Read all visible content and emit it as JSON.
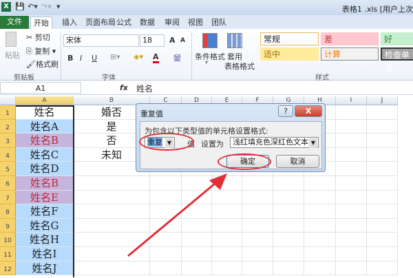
{
  "window": {
    "title": "表格1 .xls [用户上次"
  },
  "tabs": [
    "文件",
    "开始",
    "插入",
    "页面布局",
    "公式",
    "数据",
    "审阅",
    "视图",
    "团队"
  ],
  "ribbon": {
    "clipboard": {
      "paste": "粘贴",
      "cut": "剪切",
      "copy": "复制",
      "format_painter": "格式刷",
      "label": "剪贴板"
    },
    "font": {
      "name": "宋体",
      "size": "18",
      "label": "字体",
      "bold": "B",
      "italic": "I",
      "underline": "U",
      "font_color": "A",
      "grow": "A",
      "shrink": "A",
      "phonetic": "變"
    },
    "styles": {
      "conditional": "条件格式",
      "table_format_1": "套用",
      "table_format_2": "表格格式",
      "label": "样式",
      "items": [
        {
          "label": "常规",
          "bg": "#ffffff",
          "fg": "#222222"
        },
        {
          "label": "差",
          "bg": "#ffc7ce",
          "fg": "#9c0006"
        },
        {
          "label": "好",
          "bg": "#c6efce",
          "fg": "#006100"
        },
        {
          "label": "适中",
          "bg": "#ffeb9c",
          "fg": "#9c6500"
        },
        {
          "label": "计算",
          "bg": "#f2f2f2",
          "fg": "#fa7d00"
        },
        {
          "label": "检查单元",
          "bg": "#a5a5a5",
          "fg": "#ffffff"
        }
      ]
    }
  },
  "formula_bar": {
    "name_box": "A1",
    "fx": "fx",
    "value": "姓名"
  },
  "columns": [
    "A",
    "B",
    "C",
    "D",
    "E",
    "F",
    "G",
    "H",
    "I",
    "J"
  ],
  "rows": [
    {
      "n": "1",
      "a": "姓名",
      "b": "婚否",
      "style": "plain"
    },
    {
      "n": "2",
      "a": "姓名A",
      "b": "是",
      "style": "blue"
    },
    {
      "n": "3",
      "a": "姓名B",
      "b": "否",
      "style": "dup"
    },
    {
      "n": "4",
      "a": "姓名C",
      "b": "未知",
      "style": "blue"
    },
    {
      "n": "5",
      "a": "姓名D",
      "b": "",
      "style": "blue"
    },
    {
      "n": "6",
      "a": "姓名B",
      "b": "",
      "style": "dup"
    },
    {
      "n": "7",
      "a": "姓名E",
      "b": "",
      "style": "dup"
    },
    {
      "n": "8",
      "a": "姓名F",
      "b": "",
      "style": "blue"
    },
    {
      "n": "9",
      "a": "姓名G",
      "b": "",
      "style": "blue"
    },
    {
      "n": "10",
      "a": "姓名H",
      "b": "",
      "style": "blue"
    },
    {
      "n": "11",
      "a": "姓名I",
      "b": "",
      "style": "blue"
    },
    {
      "n": "12",
      "a": "姓名J",
      "b": "",
      "style": "blue"
    }
  ],
  "dialog": {
    "title": "重复值",
    "help": "?",
    "close": "X",
    "prompt": "为包含以下类型值的单元格设置格式:",
    "type_value": "重复",
    "value_label": "值",
    "set_as_label": "设置为",
    "format_value": "浅红填充色深红色文本",
    "ok": "确定",
    "cancel": "取消"
  }
}
